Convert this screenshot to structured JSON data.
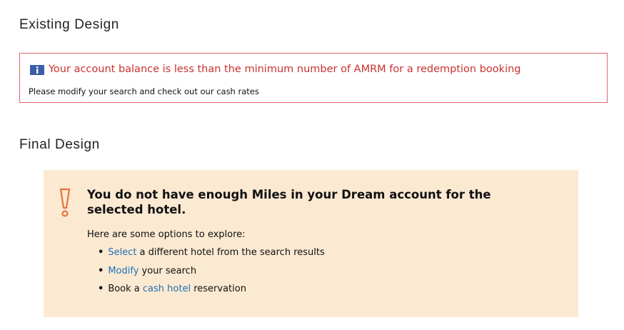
{
  "existing": {
    "heading": "Existing Design",
    "message": "Your account balance is less than the minimum number of AMRM for a redemption booking",
    "subtext": "Please modify your search and check out our cash rates",
    "icon": "info-icon",
    "border_color": "#e0656a",
    "message_color": "#c8322f"
  },
  "final": {
    "heading": "Final Design",
    "icon": "warning-icon",
    "accent_color": "#e8733a",
    "background_color": "#fbe9d2",
    "link_color": "#1e70b5",
    "title": "You do not have enough Miles in your Dream account for the selected hotel.",
    "intro": "Here are some options to explore:",
    "options": [
      {
        "prefix": "",
        "link": "Select",
        "suffix": " a different hotel from the search results"
      },
      {
        "prefix": "",
        "link": "Modify",
        "suffix": " your search"
      },
      {
        "prefix": "Book a ",
        "link": "cash hotel",
        "suffix": " reservation"
      }
    ]
  }
}
